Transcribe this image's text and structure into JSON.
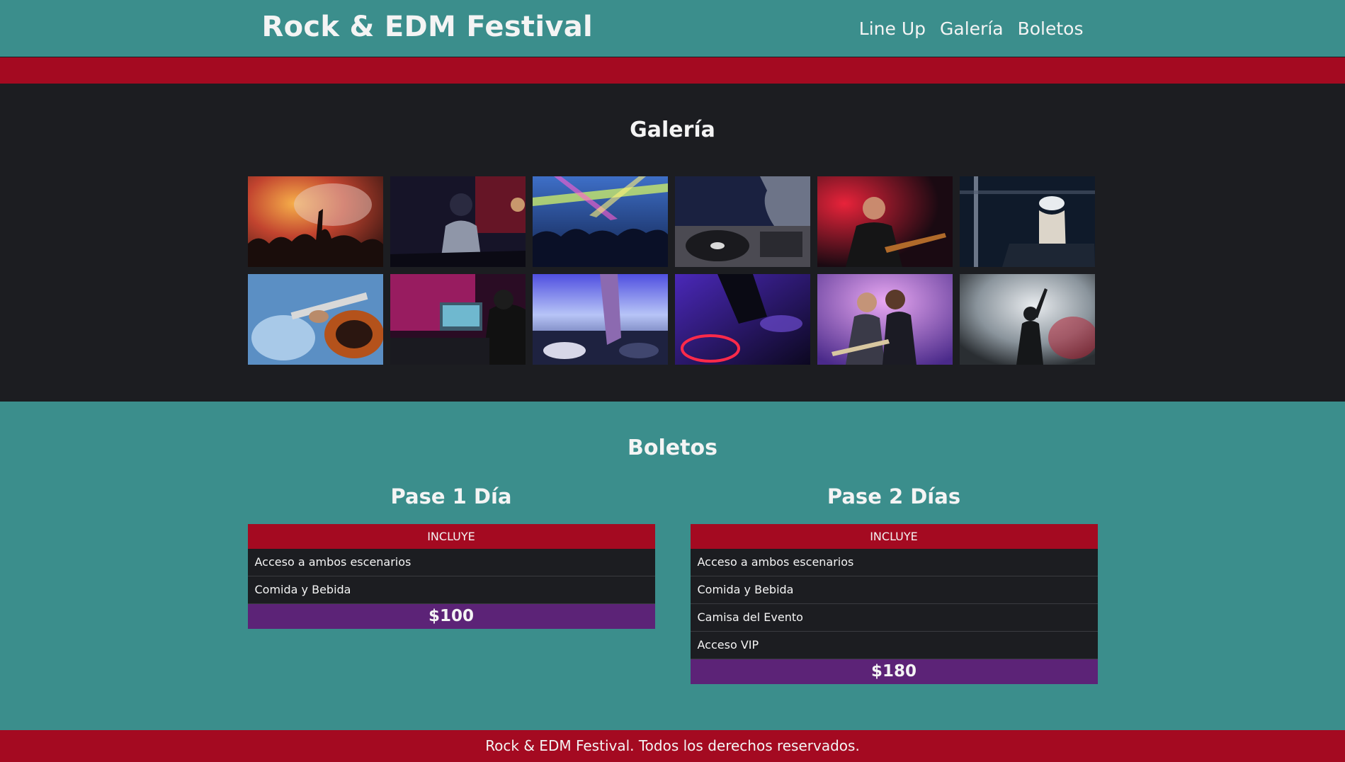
{
  "header": {
    "logo": "Rock & EDM Festival",
    "nav": [
      "Line Up",
      "Galería",
      "Boletos"
    ]
  },
  "gallery": {
    "title": "Galería",
    "photos": [
      "crowd-hands-concert-photo",
      "singer-performing-photo",
      "rave-crowd-lights-photo",
      "dj-turntable-photo",
      "guitarist-red-light-photo",
      "dj-woman-cap-photo",
      "guitars-closeup-photo",
      "dj-laptop-photo",
      "dj-mixer-blue-photo",
      "dj-hand-purple-photo",
      "duo-guitarists-photo",
      "singer-smoke-photo"
    ]
  },
  "tickets": {
    "title": "Boletos",
    "plans": [
      {
        "title": "Pase 1 Día",
        "header": "INCLUYE",
        "items": [
          "Acceso a ambos escenarios",
          "Comida y Bebida"
        ],
        "price": "$100"
      },
      {
        "title": "Pase 2 Días",
        "header": "INCLUYE",
        "items": [
          "Acceso a ambos escenarios",
          "Comida y Bebida",
          "Camisa del Evento",
          "Acceso VIP"
        ],
        "price": "$180"
      }
    ]
  },
  "footer": {
    "text": "Rock & EDM Festival. Todos los derechos reservados."
  },
  "colors": {
    "teal": "#3b8e8c",
    "red": "#a40a21",
    "dark": "#1c1d21",
    "purple": "#5c2377"
  }
}
